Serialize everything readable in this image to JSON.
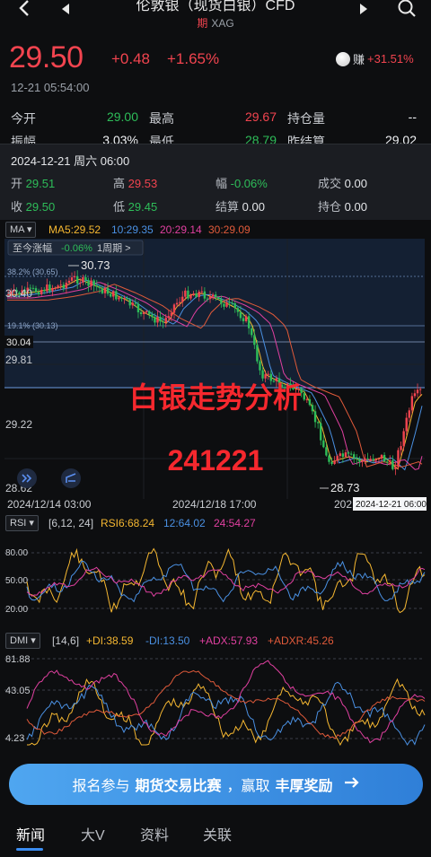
{
  "nav": {
    "title": "伦敦银（现货白银）CFD",
    "subtitle_tag": "期",
    "subtitle": "XAG"
  },
  "quote": {
    "price": "29.50",
    "change": "+0.48",
    "change_pct": "+1.65%",
    "profit_label": "赚",
    "profit_value": "+31.51%",
    "time": "12-21 05:54:00"
  },
  "stats": [
    {
      "label": "今开",
      "value": "29.00",
      "label2": "最高",
      "value2": "29.67",
      "label3": "持仓量",
      "value3": "--"
    },
    {
      "label": "振幅",
      "value": "3.03%",
      "label2": "最低",
      "value2": "28.79",
      "label3": "昨结算",
      "value3": "29.02"
    }
  ],
  "card": {
    "date": "2024-12-21 周六 06:00",
    "open_label": "开",
    "open": "29.51",
    "high_label": "高",
    "high": "29.53",
    "amp_label": "幅",
    "amp": "-0.06%",
    "vol_label": "成交",
    "vol": "0.00",
    "close_label": "收",
    "close": "29.50",
    "low_label": "低",
    "low": "29.45",
    "settle_label": "结算",
    "settle": "0.00",
    "oi_label": "持仓",
    "oi": "0.00"
  },
  "ma_bar": {
    "selector": "MA",
    "ma5": "MA5:29.52",
    "ma10": "10:29.35",
    "ma20": "20:29.14",
    "ma30": "30:29.09"
  },
  "main_chart": {
    "change_label": "至今涨幅",
    "change_value": "-0.06%",
    "period": "1周期 >",
    "fib_382": "38.2% (30.65)",
    "fib_191": "19.1% (30.13)",
    "high_mark": "30.73",
    "low_mark": "28.73",
    "y_labels": [
      "30.40",
      "30.04",
      "29.81",
      "29.22",
      "28.62"
    ],
    "x_labels": [
      "2024/12/14 03:00",
      "2024/12/18 17:00",
      "202"
    ],
    "crosshair_time": "2024-12-21 06:00",
    "overlay_title": "白银走势分析",
    "overlay_code": "241221"
  },
  "rsi_bar": {
    "selector": "RSI",
    "params": "[6,12, 24]",
    "rsi6": "RSI6:68.24",
    "rsi12": "12:64.02",
    "rsi24": "24:54.27",
    "y_labels": [
      "80.00",
      "50.00",
      "20.00"
    ]
  },
  "dmi_bar": {
    "selector": "DMI",
    "params": "[14,6]",
    "pdi": "+DI:38.59",
    "mdi": "-DI:13.50",
    "adx": "+ADX:57.93",
    "adxr": "+ADXR:45.26",
    "y_labels": [
      "81.88",
      "43.05",
      "4.23"
    ]
  },
  "banner": {
    "text1": "报名参与",
    "text2": "期货交易比赛",
    "text3": "，赢取",
    "text4": "丰厚奖励"
  },
  "tabs": [
    "新闻",
    "大V",
    "资料",
    "关联"
  ],
  "colors": {
    "up": "#f2444f",
    "down": "#2ebd59",
    "ma5": "#f5b731",
    "ma10": "#4a90e2",
    "ma20": "#e040a0",
    "ma30": "#e05a3a",
    "accent": "#3a8cf0"
  }
}
